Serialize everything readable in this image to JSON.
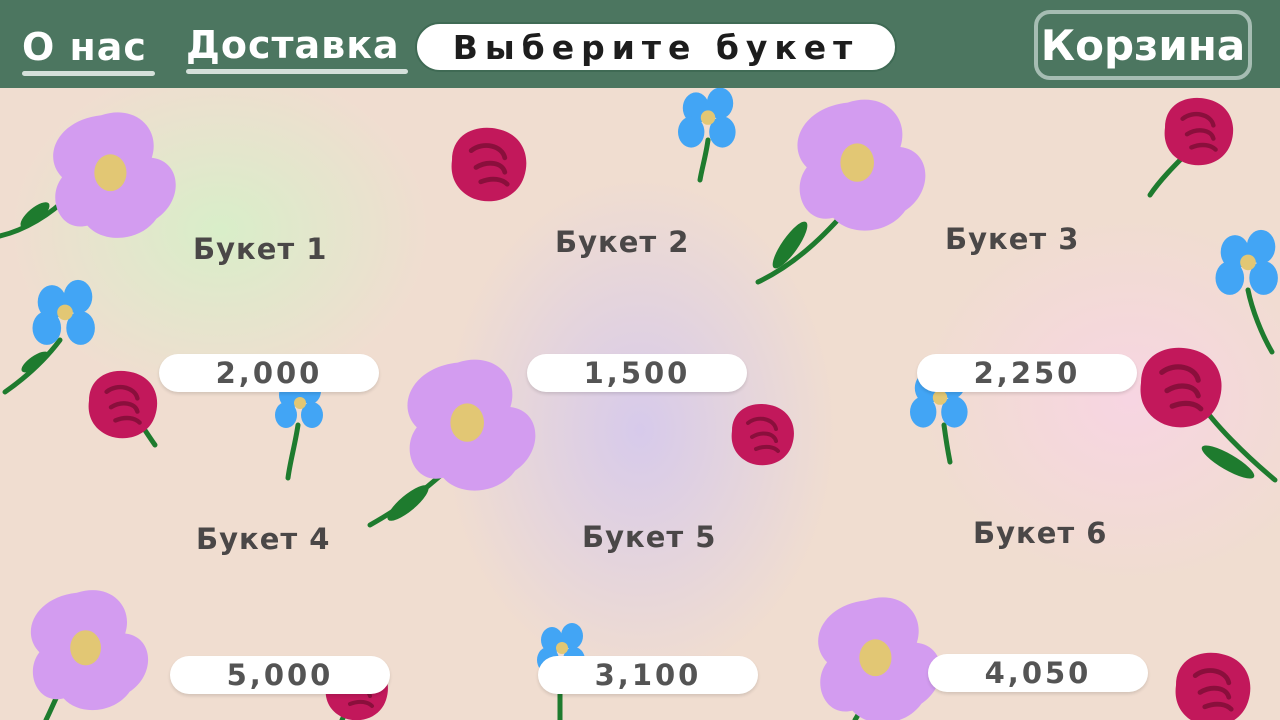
{
  "nav": {
    "about_label": "О нас",
    "delivery_label": "Доставка",
    "cart_label": "Корзина"
  },
  "search": {
    "label": "Выберите букет"
  },
  "bouquets": [
    {
      "title": "Букет 1",
      "price": "2,000"
    },
    {
      "title": "Букет 2",
      "price": "1,500"
    },
    {
      "title": "Букет 3",
      "price": "2,250"
    },
    {
      "title": "Букет 4",
      "price": "5,000"
    },
    {
      "title": "Букет 5",
      "price": "3,100"
    },
    {
      "title": "Букет 6",
      "price": "4,050"
    }
  ],
  "decor_icons": [
    "violet-flower-icon",
    "red-rose-icon",
    "blue-forget-me-not-icon"
  ],
  "colors": {
    "header": "#4c7660",
    "violet": "#d39cf0",
    "rose": "#c2185b",
    "blue": "#42a5f5",
    "stem": "#1e7b2e"
  }
}
